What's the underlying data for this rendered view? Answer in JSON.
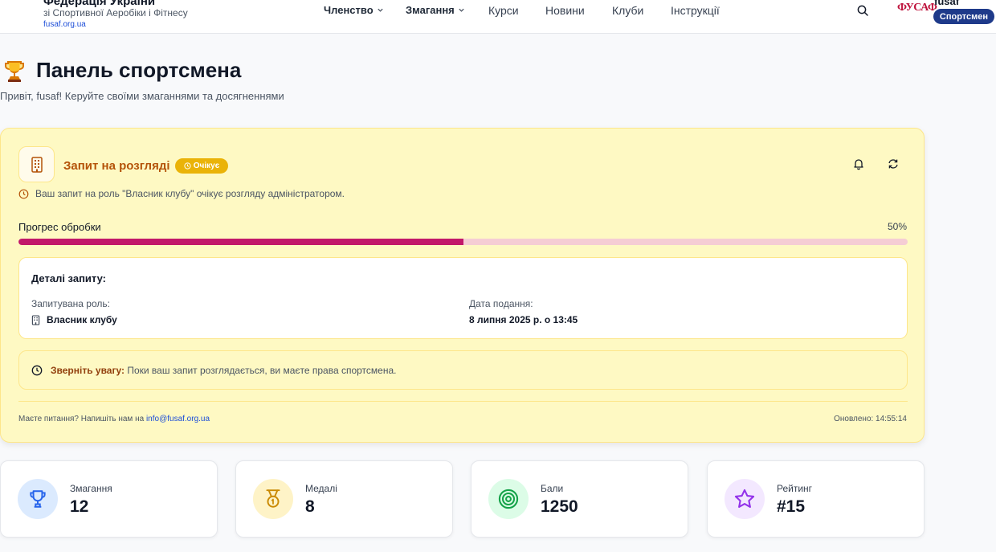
{
  "header": {
    "org_name": "Федерація України",
    "org_sub": "зі Спортивної Аеробіки і Фітнесу",
    "org_site": "fusaf.org.ua",
    "nav": [
      {
        "label": "Членство",
        "has_dropdown": true
      },
      {
        "label": "Змагання",
        "has_dropdown": true
      },
      {
        "label": "Курси"
      },
      {
        "label": "Новини"
      },
      {
        "label": "Клуби"
      },
      {
        "label": "Інструкції"
      }
    ],
    "search_icon": "search-icon",
    "logo_text": "ФУСАФ",
    "username": "fusaf",
    "role_badge": "Спортсмен"
  },
  "page": {
    "title_icon": "trophy-icon",
    "title": "Панель спортсмена",
    "subtitle": "Привіт, fusaf! Керуйте своїми змаганнями та досягненнями"
  },
  "request": {
    "title": "Запит на розгляді",
    "status": "Очікує",
    "message": "Ваш запит на роль \"Власник клубу\" очікує розгляду адміністратором.",
    "progress_label": "Прогрес обробки",
    "progress_text": "50%",
    "progress": 0.5,
    "details": {
      "title": "Деталі запиту:",
      "role_label": "Запитувана роль:",
      "role_value": "Власник клубу",
      "date_label": "Дата подання:",
      "date_value": "8 липня 2025 р. о 13:45"
    },
    "notice_strong": "Зверніть увагу:",
    "notice_text": " Поки ваш запит розглядається, ви маєте права спортсмена.",
    "footer_text": "Маєте питання? Напишіть нам на ",
    "footer_email": "info@fusaf.org.ua",
    "updated": "Оновлено: 14:55:14"
  },
  "stats": [
    {
      "label": "Змагання",
      "value": "12",
      "icon": "trophy-icon",
      "bg": "#dbeafe",
      "color": "#2563eb"
    },
    {
      "label": "Медалі",
      "value": "8",
      "icon": "medal-icon",
      "bg": "#fef3c7",
      "color": "#ca8a04"
    },
    {
      "label": "Бали",
      "value": "1250",
      "icon": "target-icon",
      "bg": "#dcfce7",
      "color": "#16a34a"
    },
    {
      "label": "Рейтинг",
      "value": "#15",
      "icon": "star-icon",
      "bg": "#f3e8ff",
      "color": "#9333ea"
    }
  ],
  "colors": {
    "accent": "#c2186a",
    "card_bg": "#fef9c3",
    "pill": "#eab308",
    "badge": "#1e3a8a"
  }
}
